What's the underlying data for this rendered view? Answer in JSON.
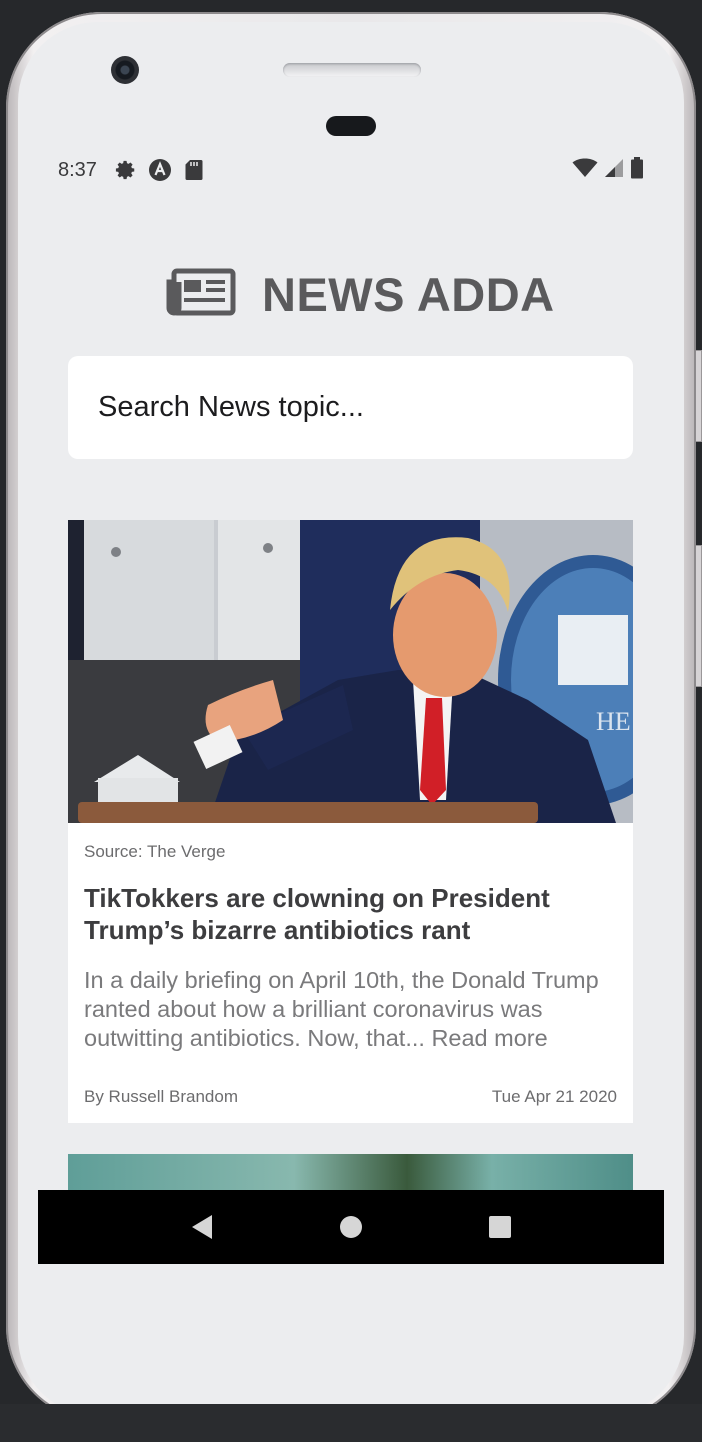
{
  "status_bar": {
    "time": "8:37",
    "left_icons": [
      "gear-icon",
      "android-a-icon",
      "sd-card-icon"
    ],
    "right_icons": [
      "wifi-icon",
      "cell-signal-icon",
      "battery-icon"
    ]
  },
  "app": {
    "title": "NEWS ADDA",
    "logo_icon": "newspaper-icon"
  },
  "search": {
    "placeholder": "Search News topic..."
  },
  "article": {
    "source": "Source: The Verge",
    "title": "TikTokkers are clowning on President Trump’s bizarre antibiotics rant",
    "description": "In a daily briefing on April 10th, the Donald Trump ranted about how a brilliant coronavirus was outwitting antibiotics. Now, that... Read more",
    "author": "By Russell Brandom",
    "date": "Tue Apr 21 2020"
  },
  "nav_bar": {
    "back_icon": "back-triangle-icon",
    "home_icon": "home-circle-icon",
    "recents_icon": "recents-square-icon"
  }
}
